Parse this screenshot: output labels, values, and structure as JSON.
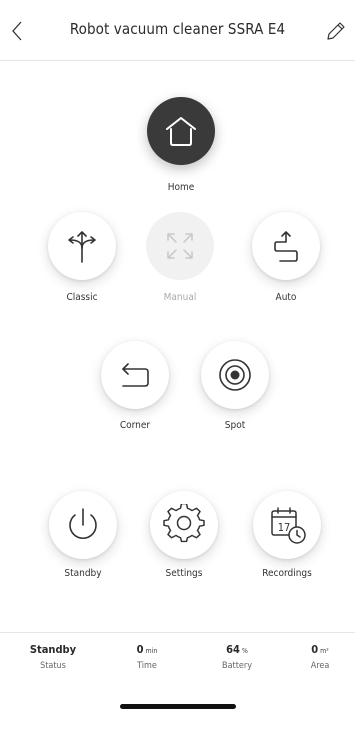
{
  "header": {
    "title": "Robot vacuum cleaner SSRA E4",
    "back_icon": "chevron-left-icon",
    "edit_icon": "pencil-icon"
  },
  "modes": {
    "home": "Home",
    "classic": "Classic",
    "manual": "Manual",
    "auto": "Auto",
    "corner": "Corner",
    "spot": "Spot",
    "standby": "Standby",
    "settings": "Settings",
    "recordings": "Recordings"
  },
  "calendar_icon_day": "17",
  "status": {
    "status_value": "Standby",
    "status_label": "Status",
    "time_value": "0",
    "time_unit": "min",
    "time_label": "Time",
    "battery_value": "64",
    "battery_unit": "%",
    "battery_label": "Battery",
    "area_value": "0",
    "area_unit": "m²",
    "area_label": "Area"
  },
  "colors": {
    "active_button": "#3a3a3a",
    "disabled_button": "#f1f1f1",
    "disabled_text": "#a9a9a9"
  }
}
